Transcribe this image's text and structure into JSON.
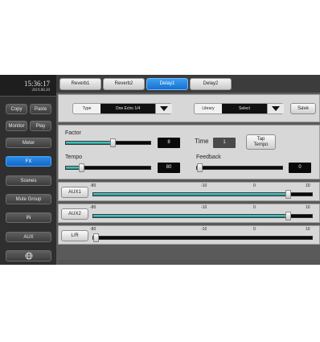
{
  "status": {
    "time": "15:36:17",
    "date": "2019.08.20"
  },
  "sidebar": {
    "copy": "Copy",
    "paste": "Paste",
    "monitor": "Monitor",
    "play": "Play",
    "meter": "Meter",
    "fx": "FX",
    "scenes": "Scenes",
    "mute_group": "Mute Group",
    "in": "IN",
    "aux": "AUX",
    "globe_icon": "globe-icon"
  },
  "tabs": [
    "Reverb1",
    "Reverb2",
    "Delay1",
    "Delay2"
  ],
  "active_tab": "Delay1",
  "preset": {
    "type_label": "Type",
    "type_value": "One Echo 1/4",
    "library_label": "Library",
    "library_value": "Select",
    "save_label": "Save"
  },
  "params": {
    "factor_label": "Factor",
    "factor_value": "8",
    "factor_level": 0.55,
    "time_label": "Time",
    "time_value": "1",
    "tap_tempo_label": "Tap Tempo",
    "tempo_label": "Tempo",
    "tempo_value": "80",
    "tempo_level": 0.18,
    "feedback_label": "Feedback",
    "feedback_value": "0",
    "feedback_level": 0.0
  },
  "sends": [
    {
      "label": "AUX1",
      "level_db": 0,
      "fill": true
    },
    {
      "label": "AUX2",
      "level_db": 0,
      "fill": true
    },
    {
      "label": "L/R",
      "level_db": -80,
      "fill": false
    }
  ],
  "scale": [
    "-80",
    "-10",
    "0",
    "10"
  ],
  "colors": {
    "accent": "#1a6fd0",
    "fader_fill": "#2aa8a8"
  }
}
